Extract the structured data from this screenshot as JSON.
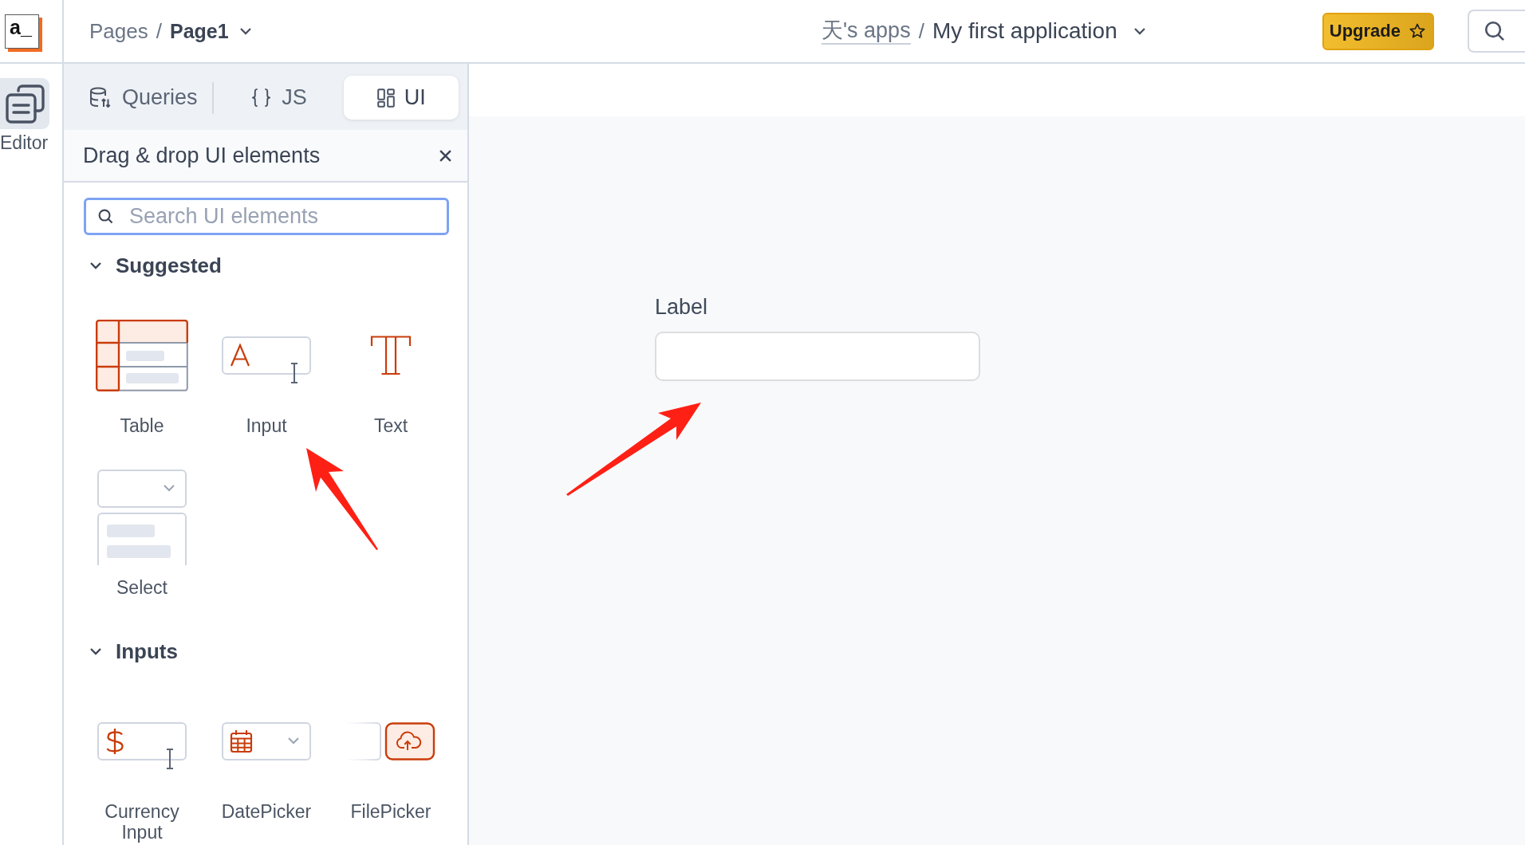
{
  "top_bar": {
    "logo": "a_",
    "breadcrumb": {
      "section": "Pages",
      "separator": "/",
      "page": "Page1"
    },
    "app_path": {
      "workspace": "天's apps",
      "separator": "/",
      "application": "My first application"
    },
    "upgrade_button": {
      "label": "Upgrade"
    }
  },
  "sidebar": {
    "items": [
      {
        "label": "Editor",
        "selected": true
      }
    ]
  },
  "widget_panel": {
    "tabs": [
      {
        "label": "Queries",
        "kind": "queries",
        "selected": false
      },
      {
        "label": "JS",
        "kind": "js",
        "selected": false
      },
      {
        "label": "UI",
        "kind": "ui",
        "selected": true
      }
    ],
    "title": "Drag & drop UI elements",
    "search": {
      "placeholder": "Search UI elements",
      "focused": true
    },
    "sections": [
      {
        "title": "Suggested",
        "expanded": true,
        "items": [
          {
            "label": "Table",
            "kind": "table"
          },
          {
            "label": "Input",
            "kind": "input"
          },
          {
            "label": "Text",
            "kind": "text"
          },
          {
            "label": "Select",
            "kind": "select"
          }
        ]
      },
      {
        "title": "Inputs",
        "expanded": true,
        "items": [
          {
            "label": "Currency Input",
            "kind": "currency"
          },
          {
            "label": "DatePicker",
            "kind": "datepicker"
          },
          {
            "label": "FilePicker",
            "kind": "filepicker"
          }
        ]
      }
    ]
  },
  "canvas": {
    "input_widget": {
      "label": "Label"
    }
  }
}
